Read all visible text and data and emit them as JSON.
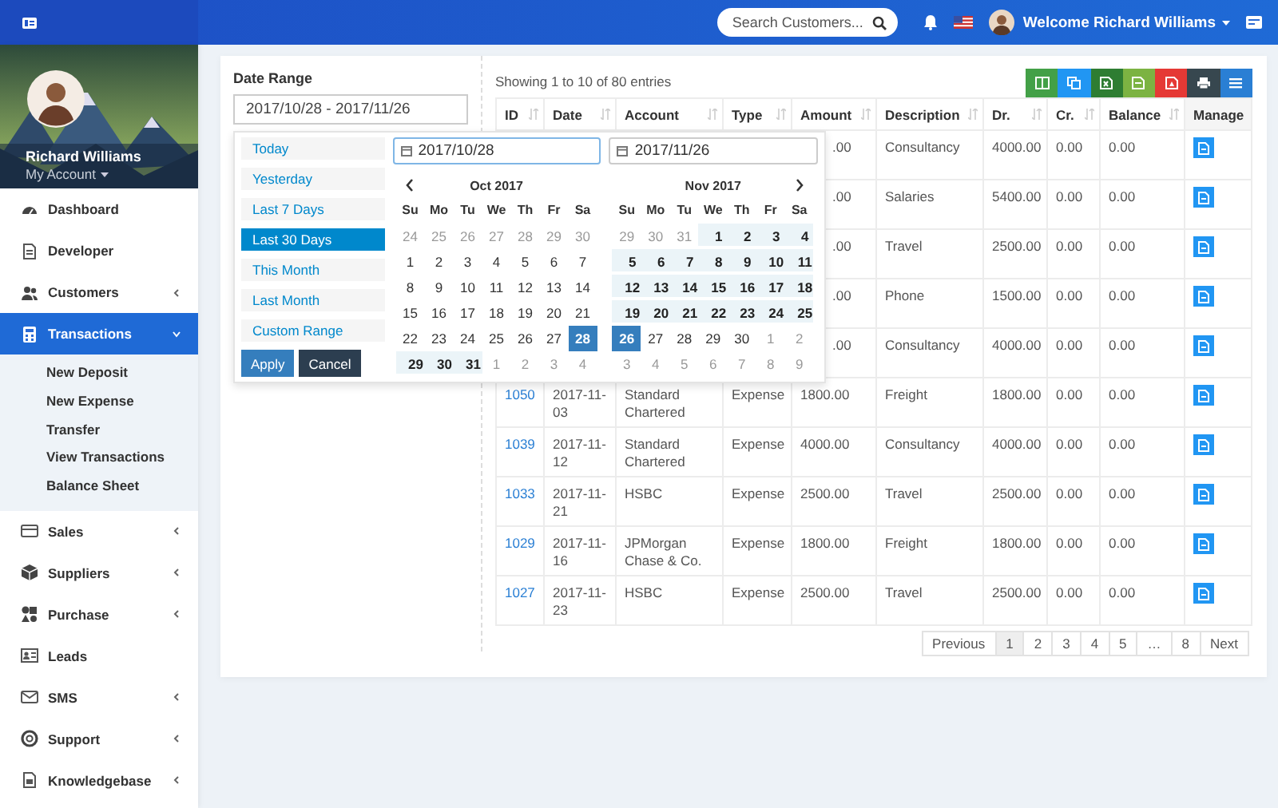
{
  "topbar": {
    "search": {
      "placeholder": "Search Customers..."
    },
    "welcome": "Welcome Richard Williams"
  },
  "profile": {
    "name": "Richard Williams",
    "account": "My Account"
  },
  "sidebar": {
    "items": [
      {
        "label": "Dashboard",
        "has_submenu": false,
        "selected": false
      },
      {
        "label": "Developer",
        "has_submenu": false,
        "selected": false
      },
      {
        "label": "Customers",
        "has_submenu": true,
        "expanded": false,
        "selected": false
      },
      {
        "label": "Transactions",
        "has_submenu": true,
        "expanded": true,
        "selected": true,
        "children": [
          {
            "label": "New Deposit"
          },
          {
            "label": "New Expense"
          },
          {
            "label": "Transfer"
          },
          {
            "label": "View Transactions"
          },
          {
            "label": "Balance Sheet"
          }
        ]
      },
      {
        "label": "Sales",
        "has_submenu": true,
        "expanded": false,
        "selected": false
      },
      {
        "label": "Suppliers",
        "has_submenu": true,
        "expanded": false,
        "selected": false
      },
      {
        "label": "Purchase",
        "has_submenu": true,
        "expanded": false,
        "selected": false
      },
      {
        "label": "Leads",
        "has_submenu": false,
        "selected": false
      },
      {
        "label": "SMS",
        "has_submenu": true,
        "expanded": false,
        "selected": false
      },
      {
        "label": "Support",
        "has_submenu": true,
        "expanded": false,
        "selected": false
      },
      {
        "label": "Knowledgebase",
        "has_submenu": true,
        "expanded": false,
        "selected": false
      }
    ]
  },
  "date_range": {
    "label": "Date Range",
    "value": "2017/10/28 - 2017/11/26"
  },
  "picker": {
    "ranges": [
      {
        "label": "Today",
        "selected": false
      },
      {
        "label": "Yesterday",
        "selected": false
      },
      {
        "label": "Last 7 Days",
        "selected": false
      },
      {
        "label": "Last 30 Days",
        "selected": true
      },
      {
        "label": "This Month",
        "selected": false
      },
      {
        "label": "Last Month",
        "selected": false
      },
      {
        "label": "Custom Range",
        "selected": false
      }
    ],
    "buttons": [
      {
        "label": "Apply",
        "kind": "primary"
      },
      {
        "label": "Cancel",
        "kind": "secondary"
      }
    ],
    "calendars": [
      {
        "input": {
          "value": "2017/10/28",
          "focused": true
        },
        "title": "Oct 2017",
        "weekdays": [
          "Su",
          "Mo",
          "Tu",
          "We",
          "Th",
          "Fr",
          "Sa"
        ],
        "weeks": [
          [
            {
              "label": "24",
              "kind": "off"
            },
            {
              "label": "25",
              "kind": "off"
            },
            {
              "label": "26",
              "kind": "off"
            },
            {
              "label": "27",
              "kind": "off"
            },
            {
              "label": "28",
              "kind": "off"
            },
            {
              "label": "29",
              "kind": "off"
            },
            {
              "label": "30",
              "kind": "off"
            }
          ],
          [
            {
              "label": "1",
              "kind": "day"
            },
            {
              "label": "2",
              "kind": "day"
            },
            {
              "label": "3",
              "kind": "day"
            },
            {
              "label": "4",
              "kind": "day"
            },
            {
              "label": "5",
              "kind": "day"
            },
            {
              "label": "6",
              "kind": "day"
            },
            {
              "label": "7",
              "kind": "day"
            }
          ],
          [
            {
              "label": "8",
              "kind": "day"
            },
            {
              "label": "9",
              "kind": "day"
            },
            {
              "label": "10",
              "kind": "day"
            },
            {
              "label": "11",
              "kind": "day"
            },
            {
              "label": "12",
              "kind": "day"
            },
            {
              "label": "13",
              "kind": "day"
            },
            {
              "label": "14",
              "kind": "day"
            }
          ],
          [
            {
              "label": "15",
              "kind": "day"
            },
            {
              "label": "16",
              "kind": "day"
            },
            {
              "label": "17",
              "kind": "day"
            },
            {
              "label": "18",
              "kind": "day"
            },
            {
              "label": "19",
              "kind": "day"
            },
            {
              "label": "20",
              "kind": "day"
            },
            {
              "label": "21",
              "kind": "day"
            }
          ],
          [
            {
              "label": "22",
              "kind": "day"
            },
            {
              "label": "23",
              "kind": "day"
            },
            {
              "label": "24",
              "kind": "day"
            },
            {
              "label": "25",
              "kind": "day"
            },
            {
              "label": "26",
              "kind": "day"
            },
            {
              "label": "27",
              "kind": "day"
            },
            {
              "label": "28",
              "kind": "end"
            }
          ],
          [
            {
              "label": "29",
              "kind": "range"
            },
            {
              "label": "30",
              "kind": "range"
            },
            {
              "label": "31",
              "kind": "range"
            },
            {
              "label": "1",
              "kind": "off"
            },
            {
              "label": "2",
              "kind": "off"
            },
            {
              "label": "3",
              "kind": "off"
            },
            {
              "label": "4",
              "kind": "off"
            }
          ]
        ]
      },
      {
        "input": {
          "value": "2017/11/26",
          "focused": false
        },
        "title": "Nov 2017",
        "weekdays": [
          "Su",
          "Mo",
          "Tu",
          "We",
          "Th",
          "Fr",
          "Sa"
        ],
        "weeks": [
          [
            {
              "label": "29",
              "kind": "off"
            },
            {
              "label": "30",
              "kind": "off"
            },
            {
              "label": "31",
              "kind": "off"
            },
            {
              "label": "1",
              "kind": "range"
            },
            {
              "label": "2",
              "kind": "range"
            },
            {
              "label": "3",
              "kind": "range"
            },
            {
              "label": "4",
              "kind": "range"
            }
          ],
          [
            {
              "label": "5",
              "kind": "range"
            },
            {
              "label": "6",
              "kind": "range"
            },
            {
              "label": "7",
              "kind": "range"
            },
            {
              "label": "8",
              "kind": "range"
            },
            {
              "label": "9",
              "kind": "range"
            },
            {
              "label": "10",
              "kind": "range"
            },
            {
              "label": "11",
              "kind": "range"
            }
          ],
          [
            {
              "label": "12",
              "kind": "range"
            },
            {
              "label": "13",
              "kind": "range"
            },
            {
              "label": "14",
              "kind": "range"
            },
            {
              "label": "15",
              "kind": "range"
            },
            {
              "label": "16",
              "kind": "range"
            },
            {
              "label": "17",
              "kind": "range"
            },
            {
              "label": "18",
              "kind": "range"
            }
          ],
          [
            {
              "label": "19",
              "kind": "range"
            },
            {
              "label": "20",
              "kind": "range"
            },
            {
              "label": "21",
              "kind": "range"
            },
            {
              "label": "22",
              "kind": "range"
            },
            {
              "label": "23",
              "kind": "range"
            },
            {
              "label": "24",
              "kind": "range"
            },
            {
              "label": "25",
              "kind": "range"
            }
          ],
          [
            {
              "label": "26",
              "kind": "end"
            },
            {
              "label": "27",
              "kind": "day"
            },
            {
              "label": "28",
              "kind": "day"
            },
            {
              "label": "29",
              "kind": "day"
            },
            {
              "label": "30",
              "kind": "day"
            },
            {
              "label": "1",
              "kind": "off"
            },
            {
              "label": "2",
              "kind": "off"
            }
          ],
          [
            {
              "label": "3",
              "kind": "off"
            },
            {
              "label": "4",
              "kind": "off"
            },
            {
              "label": "5",
              "kind": "off"
            },
            {
              "label": "6",
              "kind": "off"
            },
            {
              "label": "7",
              "kind": "off"
            },
            {
              "label": "8",
              "kind": "off"
            },
            {
              "label": "9",
              "kind": "off"
            }
          ]
        ]
      }
    ]
  },
  "table": {
    "info": "Showing 1 to 10 of 80 entries",
    "columns": [
      {
        "label": "ID",
        "sortable": true
      },
      {
        "label": "Date",
        "sortable": true
      },
      {
        "label": "Account",
        "sortable": true
      },
      {
        "label": "Type",
        "sortable": true
      },
      {
        "label": "Amount",
        "sortable": true
      },
      {
        "label": "Description",
        "sortable": true
      },
      {
        "label": "Dr.",
        "sortable": true
      },
      {
        "label": "Cr.",
        "sortable": true
      },
      {
        "label": "Balance",
        "sortable": true
      },
      {
        "label": "Manage",
        "sortable": false
      }
    ],
    "rows": [
      {
        "amount": ".00",
        "description": "Consultancy",
        "dr": "4000.00",
        "cr": "0.00",
        "balance": "0.00"
      },
      {
        "amount": ".00",
        "description": "Salaries",
        "dr": "5400.00",
        "cr": "0.00",
        "balance": "0.00"
      },
      {
        "amount": ".00",
        "description": "Travel",
        "dr": "2500.00",
        "cr": "0.00",
        "balance": "0.00"
      },
      {
        "amount": ".00",
        "description": "Phone",
        "dr": "1500.00",
        "cr": "0.00",
        "balance": "0.00"
      },
      {
        "amount": ".00",
        "description": "Consultancy",
        "dr": "4000.00",
        "cr": "0.00",
        "balance": "0.00"
      },
      {
        "id": "1050",
        "date": "2017-11-03",
        "account": "Standard Chartered",
        "type": "Expense",
        "amount": "1800.00",
        "description": "Freight",
        "dr": "1800.00",
        "cr": "0.00",
        "balance": "0.00"
      },
      {
        "id": "1039",
        "date": "2017-11-12",
        "account": "Standard Chartered",
        "type": "Expense",
        "amount": "4000.00",
        "description": "Consultancy",
        "dr": "4000.00",
        "cr": "0.00",
        "balance": "0.00"
      },
      {
        "id": "1033",
        "date": "2017-11-21",
        "account": "HSBC",
        "type": "Expense",
        "amount": "2500.00",
        "description": "Travel",
        "dr": "2500.00",
        "cr": "0.00",
        "balance": "0.00"
      },
      {
        "id": "1029",
        "date": "2017-11-16",
        "account": "JPMorgan Chase & Co.",
        "type": "Expense",
        "amount": "1800.00",
        "description": "Freight",
        "dr": "1800.00",
        "cr": "0.00",
        "balance": "0.00"
      },
      {
        "id": "1027",
        "date": "2017-11-23",
        "account": "HSBC",
        "type": "Expense",
        "amount": "2500.00",
        "description": "Travel",
        "dr": "2500.00",
        "cr": "0.00",
        "balance": "0.00"
      }
    ]
  },
  "pagination": [
    {
      "label": "Previous",
      "selected": false
    },
    {
      "label": "1",
      "selected": true
    },
    {
      "label": "2",
      "selected": false
    },
    {
      "label": "3",
      "selected": false
    },
    {
      "label": "4",
      "selected": false
    },
    {
      "label": "5",
      "selected": false
    },
    {
      "label": "…",
      "selected": false
    },
    {
      "label": "8",
      "selected": false
    },
    {
      "label": "Next",
      "selected": false
    }
  ]
}
